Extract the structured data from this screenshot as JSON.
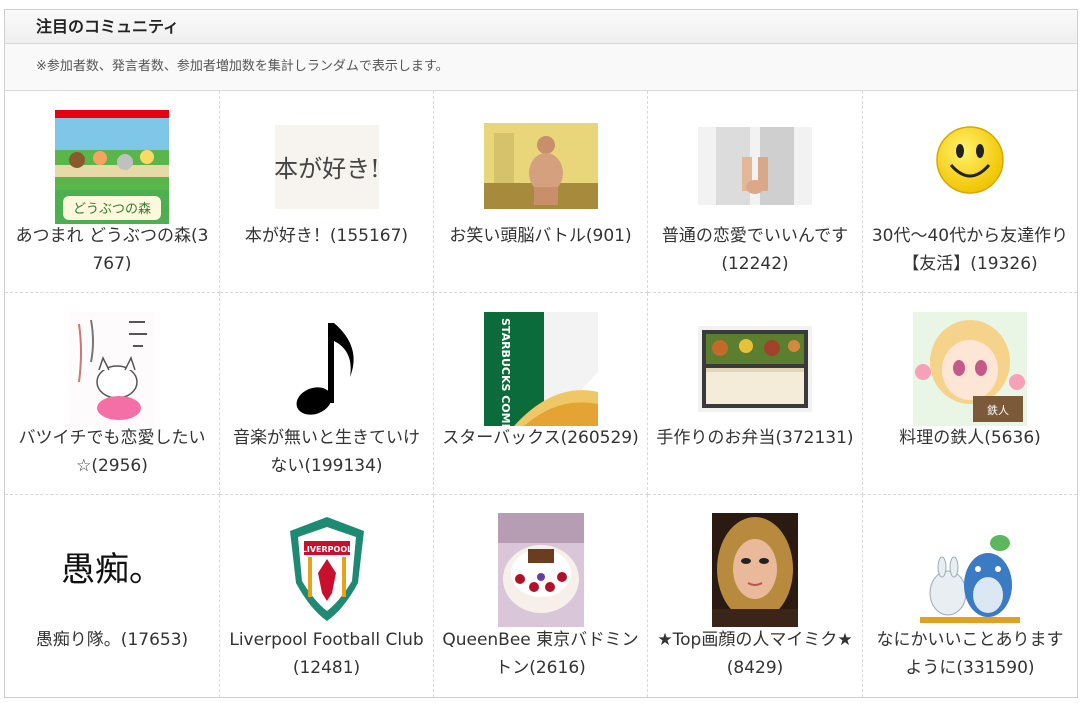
{
  "section": {
    "title": "注目のコミュニティ",
    "note": "※参加者数、発言者数、参加者増加数を集計しランダムで表示します。"
  },
  "communities": [
    {
      "name": "あつまれ どうぶつの森(3767)",
      "icon": "animal-crossing-cover-icon"
    },
    {
      "name": "本が好き！(155167)",
      "icon": "handwritten-text-icon"
    },
    {
      "name": "お笑い頭脳バトル(901)",
      "icon": "person-photo-icon"
    },
    {
      "name": "普通の恋愛でいいんです(12242)",
      "icon": "holding-hands-photo-icon"
    },
    {
      "name": "30代〜40代から友達作り【友活】(19326)",
      "icon": "smiley-face-icon"
    },
    {
      "name": "バツイチでも恋愛したい☆(2956)",
      "icon": "cat-drawing-icon"
    },
    {
      "name": "音楽が無いと生きていけない(199134)",
      "icon": "music-note-icon"
    },
    {
      "name": "スターバックス(260529)",
      "icon": "starbucks-cup-icon"
    },
    {
      "name": "手作りのお弁当(372131)",
      "icon": "bento-box-icon"
    },
    {
      "name": "料理の鉄人(5636)",
      "icon": "anime-girl-icon"
    },
    {
      "name": "愚痴り隊。(17653)",
      "icon": "calligraphy-text-icon"
    },
    {
      "name": "Liverpool Football Club(12481)",
      "icon": "liverpool-crest-icon"
    },
    {
      "name": "QueenBee 東京バドミントン(2616)",
      "icon": "cake-photo-icon"
    },
    {
      "name": "★Top画顔の人マイミク★(8429)",
      "icon": "portrait-photo-icon"
    },
    {
      "name": "なにかいいことありますように(331590)",
      "icon": "totoro-icon"
    }
  ],
  "image_text": {
    "handwritten": "本が好き!",
    "starbucks": "STARBUCKS COMMUNITY",
    "calligraphy": "愚痴。",
    "liverpool": "LIVERPOOL"
  }
}
